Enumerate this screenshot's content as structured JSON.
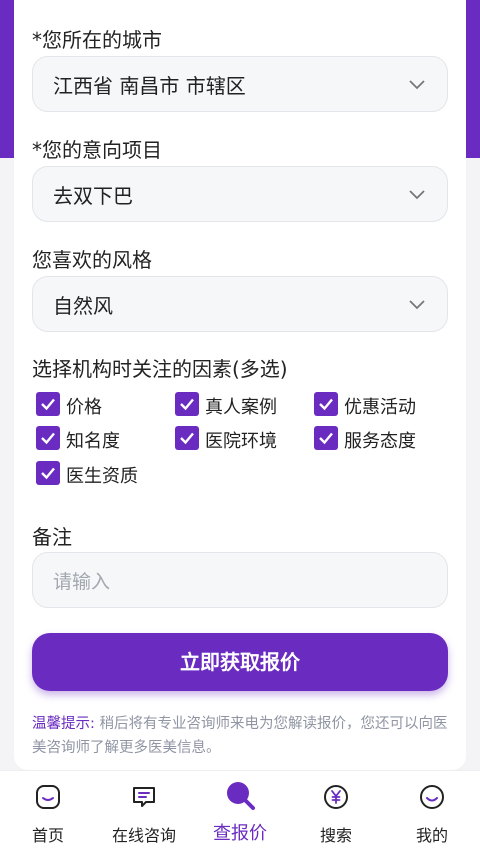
{
  "form": {
    "city_label": "*您所在的城市",
    "city_value": "江西省 南昌市 市辖区",
    "project_label": "*您的意向项目",
    "project_value": "去双下巴",
    "style_label": "您喜欢的风格",
    "style_value": "自然风",
    "factors_label": "选择机构时关注的因素(多选)",
    "factors": [
      {
        "label": "价格",
        "checked": true
      },
      {
        "label": "真人案例",
        "checked": true
      },
      {
        "label": "优惠活动",
        "checked": true
      },
      {
        "label": "知名度",
        "checked": true
      },
      {
        "label": "医院环境",
        "checked": true
      },
      {
        "label": "服务态度",
        "checked": true
      },
      {
        "label": "医生资质",
        "checked": true
      }
    ],
    "remark_label": "备注",
    "remark_placeholder": "请输入",
    "submit_label": "立即获取报价",
    "tip_key": "温馨提示:",
    "tip_text": " 稍后将有专业咨询师来电为您解读报价，您还可以向医美咨询师了解更多医美信息。"
  },
  "tabbar": {
    "tabs": [
      {
        "label": "首页",
        "icon": "home-icon"
      },
      {
        "label": "在线咨询",
        "icon": "chat-icon"
      },
      {
        "label": "查报价",
        "icon": "search-icon"
      },
      {
        "label": "搜索",
        "icon": "yen-icon"
      },
      {
        "label": "我的",
        "icon": "profile-icon"
      }
    ],
    "active_index": 2
  },
  "colors": {
    "accent": "#6a2cc0",
    "field_bg": "#f6f7f9",
    "tip_text": "#8f95a3"
  }
}
